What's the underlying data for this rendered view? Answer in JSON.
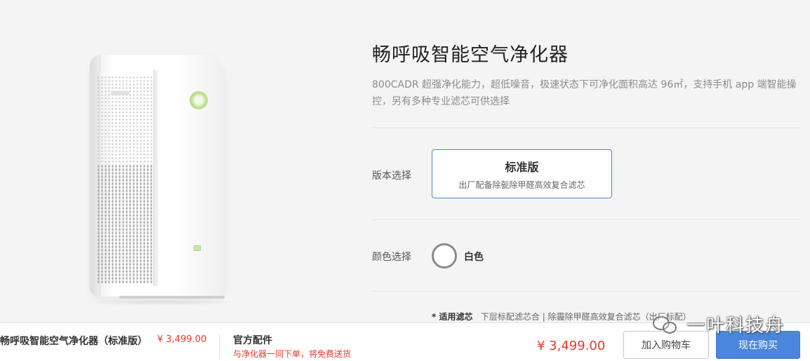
{
  "product": {
    "title": "畅呼吸智能空气净化器",
    "subtitle": "800CADR 超强净化能力，超低噪音，极速状态下可净化面积高达 96㎡，支持手机 app 端智能操控，另有多种专业滤芯可供选择"
  },
  "version": {
    "label": "版本选择",
    "option_name": "标准版",
    "option_desc": "出厂配备除甏除甲醛高效复合滤芯"
  },
  "color": {
    "label": "颜色选择",
    "option_name": "白色",
    "swatch_hex": "#ffffff"
  },
  "filter_note": {
    "title": "* 适用滤芯",
    "text": "下层标配滤芯合 | 除霾除甲醛高效复合滤芯（出厂标配）"
  },
  "bottom_bar": {
    "product_name": "畅呼吸智能空气净化器（标准版）",
    "price": "¥ 3,499.00",
    "accessory_title": "官方配件",
    "accessory_note": "与净化器一同下单，将免费送货",
    "total_price": "¥ 3,499.00",
    "add_to_cart": "加入购物车",
    "buy_now": "现在购买"
  },
  "watermark": {
    "text": "一叶科技舟"
  },
  "colors": {
    "accent_blue": "#4a86dc",
    "price_red": "#e23a2e",
    "led_green": "#b7dc86"
  }
}
